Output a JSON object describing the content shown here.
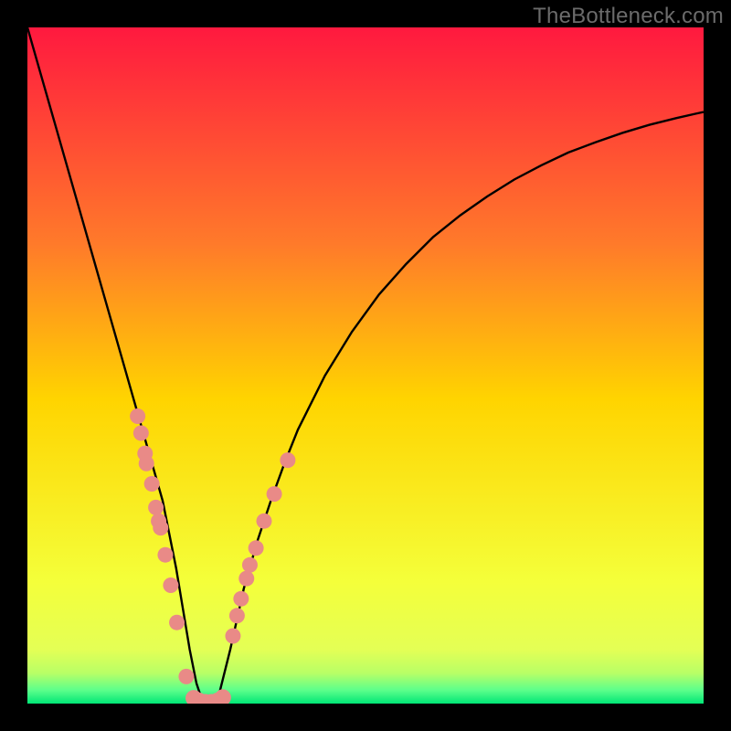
{
  "watermark": "TheBottleneck.com",
  "chart_data": {
    "type": "line",
    "title": "",
    "xlabel": "",
    "ylabel": "",
    "xlim": [
      0,
      100
    ],
    "ylim": [
      0,
      100
    ],
    "series": [
      {
        "name": "curve",
        "x": [
          0,
          2,
          4,
          6,
          8,
          10,
          12,
          14,
          16,
          17,
          18,
          19,
          20,
          21,
          22,
          23,
          24,
          25,
          26,
          27,
          28,
          29,
          30,
          31,
          32,
          34,
          36,
          38,
          40,
          44,
          48,
          52,
          56,
          60,
          64,
          68,
          72,
          76,
          80,
          84,
          88,
          92,
          96,
          100
        ],
        "y": [
          100,
          93,
          86,
          79,
          72,
          65,
          58,
          51,
          44,
          40.5,
          37,
          33.5,
          30,
          25,
          20,
          14,
          8,
          3,
          0,
          0,
          0,
          4,
          8,
          12.5,
          17,
          24,
          30,
          35.5,
          40.5,
          48.5,
          55,
          60.5,
          65,
          69,
          72.2,
          75,
          77.5,
          79.6,
          81.5,
          83,
          84.4,
          85.6,
          86.6,
          87.5
        ]
      }
    ],
    "markers": [
      {
        "name": "left-branch-dots",
        "x": [
          16.3,
          16.8,
          17.4,
          17.6,
          18.4,
          19.0,
          19.4,
          19.7,
          20.4,
          21.2,
          22.1,
          23.5
        ],
        "y": [
          42.5,
          40.0,
          37.0,
          35.5,
          32.5,
          29.0,
          27.0,
          26.0,
          22.0,
          17.5,
          12.0,
          4.0
        ]
      },
      {
        "name": "right-branch-dots",
        "x": [
          30.4,
          31.0,
          31.6,
          32.4,
          32.9,
          33.8,
          35.0,
          36.5,
          38.5
        ],
        "y": [
          10.0,
          13.0,
          15.5,
          18.5,
          20.5,
          23.0,
          27.0,
          31.0,
          36.0
        ]
      },
      {
        "name": "bottom-dots",
        "x": [
          24.6,
          25.4,
          26.3,
          27.2,
          28.1,
          28.9
        ],
        "y": [
          0.8,
          0.4,
          0.2,
          0.2,
          0.4,
          0.9
        ]
      }
    ],
    "colors": {
      "gradient_top": "#ff193f",
      "gradient_mid_upper": "#ff7a2a",
      "gradient_mid": "#ffd400",
      "gradient_lower": "#f4ff3a",
      "gradient_green1": "#b8ff66",
      "gradient_green2": "#00e676",
      "curve": "#000000",
      "marker": "#e98a87",
      "background": "#000000",
      "watermark": "#6b6b6b"
    }
  }
}
